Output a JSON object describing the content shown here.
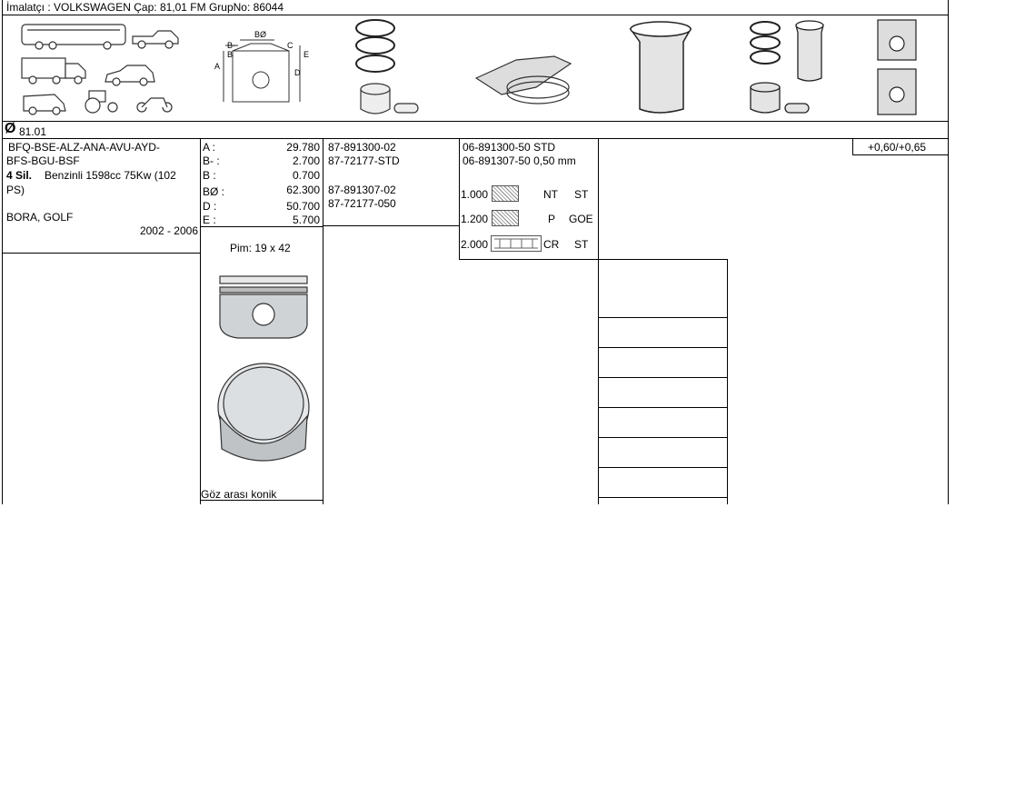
{
  "header": {
    "text": "İmalatçı : VOLKSWAGEN   Çap: 81,01   FM GrupNo: 86044"
  },
  "diameter_row": {
    "symbol": "Ø",
    "value": "81.01"
  },
  "engine": {
    "codes": [
      "BFQ-BSE-ALZ-ANA-AVU-AYD-",
      "BFS-BGU-BSF"
    ],
    "cyl": "4 Sil.",
    "spec": "Benzinli 1598cc 75Kw (102",
    "spec2": "PS)",
    "models": "BORA, GOLF",
    "years": "2002 - 2006"
  },
  "dims": [
    {
      "label": "A :",
      "value": "29.780"
    },
    {
      "label": "B- :",
      "value": "2.700"
    },
    {
      "label": "B :",
      "value": "0.700"
    },
    {
      "label": "BØ :",
      "value": "62.300"
    },
    {
      "label": "D :",
      "value": "50.700"
    },
    {
      "label": "E :",
      "value": "5.700"
    }
  ],
  "pin": "Pim: 19 x 42",
  "goz": "Göz arası konik",
  "parts": {
    "p1": "87-891300-02",
    "p2": "87-72177-STD",
    "p3": "87-891307-02",
    "p4": "87-72177-050"
  },
  "rings": {
    "r1": "06-891300-50 STD",
    "r2": "06-891307-50 0,50 mm",
    "items": [
      {
        "thick": "1.000",
        "type": "NT",
        "mat": "ST"
      },
      {
        "thick": "1.200",
        "type": "P",
        "mat": "GOE"
      },
      {
        "thick": "2.000",
        "type": "CR",
        "mat": "ST"
      }
    ]
  },
  "oversize": "+0,60/+0,65",
  "diagram_labels": {
    "b_dia": "BØ",
    "b_minus": "B-",
    "b": "B",
    "c": "C",
    "e": "E",
    "a": "A",
    "d": "D"
  }
}
